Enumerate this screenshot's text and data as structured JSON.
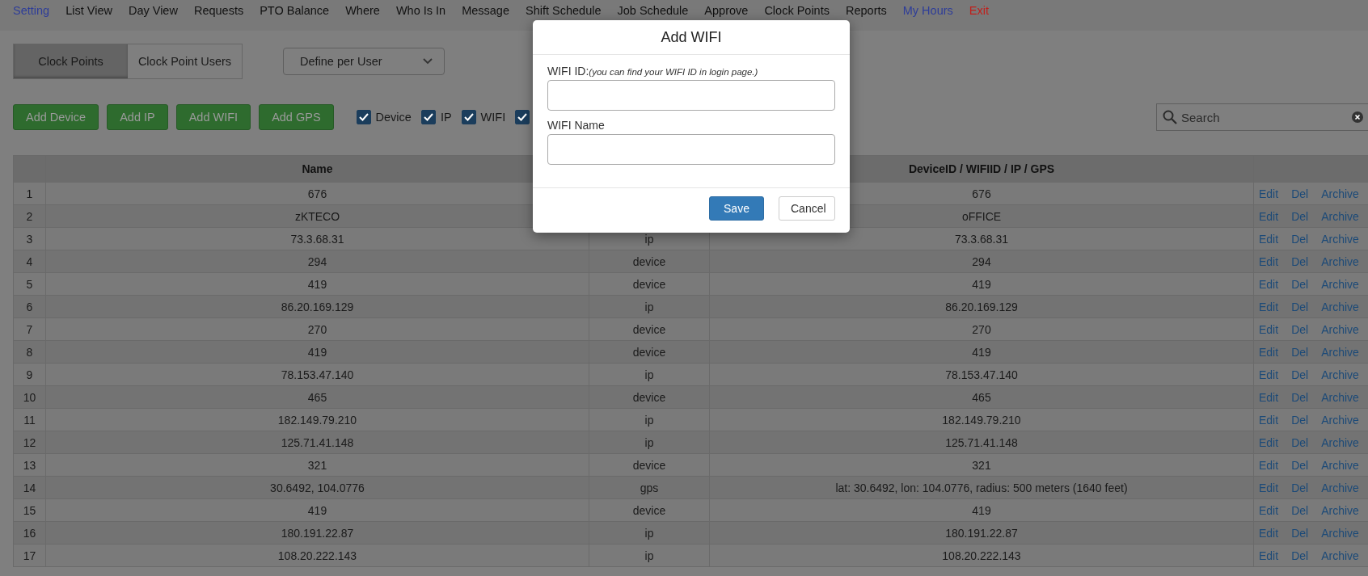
{
  "nav": [
    {
      "label": "Setting",
      "color": "#2e3d99"
    },
    {
      "label": "List View",
      "color": "#111111"
    },
    {
      "label": "Day View",
      "color": "#111111"
    },
    {
      "label": "Requests",
      "color": "#111111"
    },
    {
      "label": "PTO Balance",
      "color": "#111111"
    },
    {
      "label": "Where",
      "color": "#111111"
    },
    {
      "label": "Who Is In",
      "color": "#111111"
    },
    {
      "label": "Message",
      "color": "#111111"
    },
    {
      "label": "Shift Schedule",
      "color": "#111111"
    },
    {
      "label": "Job Schedule",
      "color": "#111111"
    },
    {
      "label": "Approve",
      "color": "#111111"
    },
    {
      "label": "Clock Points",
      "color": "#111111"
    },
    {
      "label": "Reports",
      "color": "#111111"
    },
    {
      "label": "My Hours",
      "color": "#2e3d99"
    },
    {
      "label": "Exit",
      "color": "#c0201c"
    }
  ],
  "tabs": [
    {
      "label": "Clock Points",
      "selected": true
    },
    {
      "label": "Clock Point Users",
      "selected": false
    }
  ],
  "mode_select": {
    "value": "Define per User"
  },
  "add_buttons": [
    "Add Device",
    "Add IP",
    "Add WIFI",
    "Add GPS"
  ],
  "filters": [
    {
      "label": "Device",
      "checked": true
    },
    {
      "label": "IP",
      "checked": true
    },
    {
      "label": "WIFI",
      "checked": true
    },
    {
      "checked": true
    }
  ],
  "search": {
    "placeholder": "Search"
  },
  "table": {
    "columns": {
      "name": "Name",
      "id": "DeviceID / WIFIID / IP / GPS"
    },
    "rows": [
      {
        "no": "1",
        "name": "676",
        "id": "676",
        "actions": [
          "Edit",
          "Del",
          "Archive"
        ]
      },
      {
        "no": "2",
        "name": "zKTECO",
        "id": "oFFICE",
        "actions": [
          "Edit",
          "Del",
          "Archive"
        ]
      },
      {
        "no": "3",
        "name": "73.3.68.31",
        "type": "ip",
        "id": "73.3.68.31",
        "actions": [
          "Edit",
          "Del",
          "Archive"
        ]
      },
      {
        "no": "4",
        "name": "294",
        "type": "device",
        "id": "294",
        "actions": [
          "Edit",
          "Del",
          "Archive"
        ]
      },
      {
        "no": "5",
        "name": "419",
        "type": "device",
        "id": "419",
        "actions": [
          "Edit",
          "Del",
          "Archive"
        ]
      },
      {
        "no": "6",
        "name": "86.20.169.129",
        "type": "ip",
        "id": "86.20.169.129",
        "actions": [
          "Edit",
          "Del",
          "Archive"
        ]
      },
      {
        "no": "7",
        "name": "270",
        "type": "device",
        "id": "270",
        "actions": [
          "Edit",
          "Del",
          "Archive"
        ]
      },
      {
        "no": "8",
        "name": "419",
        "type": "device",
        "id": "419",
        "actions": [
          "Edit",
          "Del",
          "Archive"
        ]
      },
      {
        "no": "9",
        "name": "78.153.47.140",
        "type": "ip",
        "id": "78.153.47.140",
        "actions": [
          "Edit",
          "Del",
          "Archive"
        ]
      },
      {
        "no": "10",
        "name": "465",
        "type": "device",
        "id": "465",
        "actions": [
          "Edit",
          "Del",
          "Archive"
        ]
      },
      {
        "no": "11",
        "name": "182.149.79.210",
        "type": "ip",
        "id": "182.149.79.210",
        "actions": [
          "Edit",
          "Del",
          "Archive"
        ]
      },
      {
        "no": "12",
        "name": "125.71.41.148",
        "type": "ip",
        "id": "125.71.41.148",
        "actions": [
          "Edit",
          "Del",
          "Archive"
        ]
      },
      {
        "no": "13",
        "name": "321",
        "type": "device",
        "id": "321",
        "actions": [
          "Edit",
          "Del",
          "Archive"
        ]
      },
      {
        "no": "14",
        "name": "30.6492, 104.0776",
        "type": "gps",
        "id": "lat: 30.6492, lon: 104.0776, radius: 500 meters (1640 feet)",
        "actions": [
          "Edit",
          "Del",
          "Archive"
        ]
      },
      {
        "no": "15",
        "name": "419",
        "type": "device",
        "id": "419",
        "actions": [
          "Edit",
          "Del",
          "Archive"
        ]
      },
      {
        "no": "16",
        "name": "180.191.22.87",
        "type": "ip",
        "id": "180.191.22.87",
        "actions": [
          "Edit",
          "Del",
          "Archive"
        ]
      },
      {
        "no": "17",
        "name": "108.20.222.143",
        "type": "ip",
        "id": "108.20.222.143",
        "actions": [
          "Edit",
          "Del",
          "Archive"
        ]
      }
    ]
  },
  "dialog": {
    "title": "Add WIFI",
    "fields": [
      {
        "label": "WIFI ID:",
        "hint": "(you can find your WIFI ID in login page.)"
      },
      {
        "label": "WIFI Name"
      }
    ],
    "buttons": [
      {
        "label": "Save",
        "kind": "primary"
      },
      {
        "label": "Cancel",
        "kind": "default"
      }
    ]
  }
}
